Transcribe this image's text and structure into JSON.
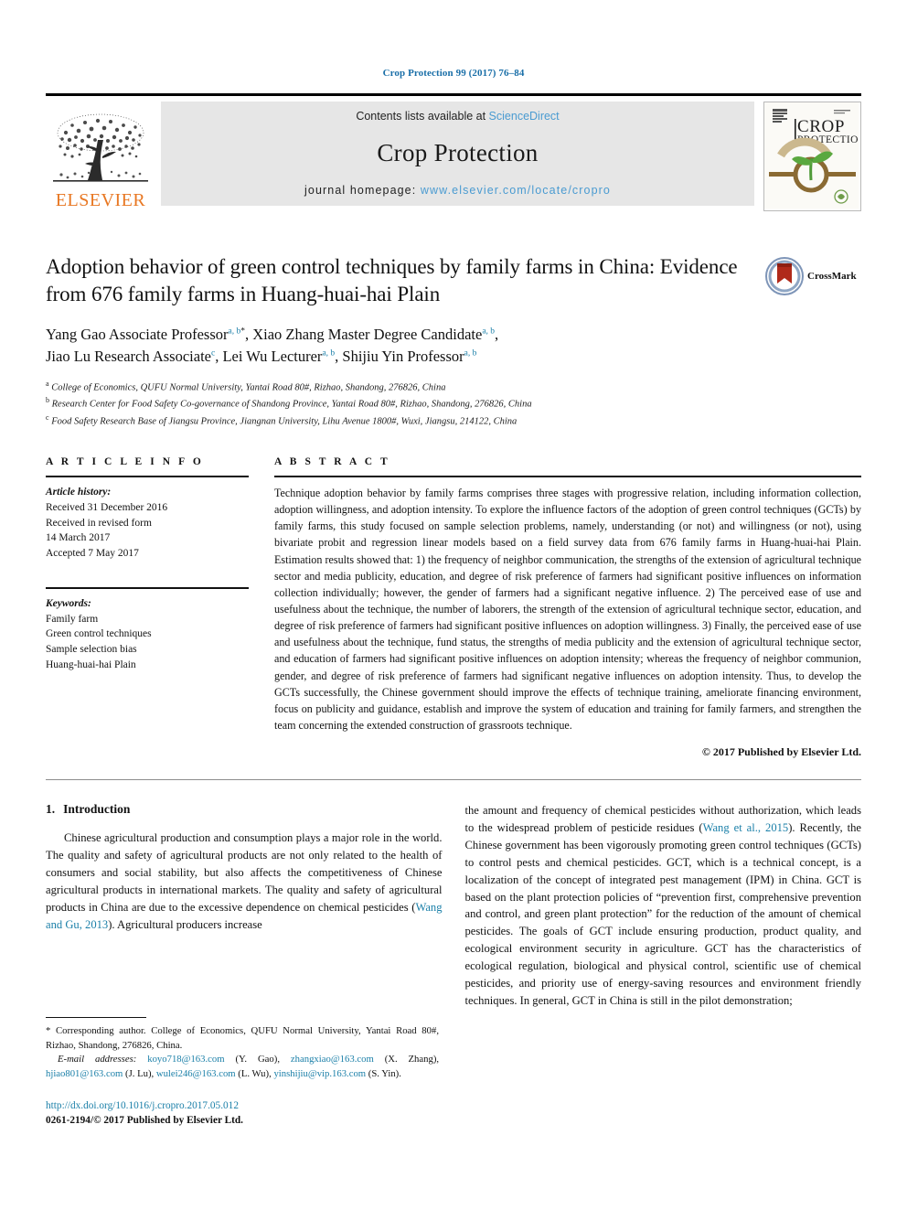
{
  "running_head": "Crop Protection 99 (2017) 76–84",
  "masthead": {
    "publisher_name": "ELSEVIER",
    "contents_prefix": "Contents lists available at ",
    "contents_link": "ScienceDirect",
    "journal_title": "Crop Protection",
    "homepage_prefix": "journal homepage: ",
    "homepage_url": "www.elsevier.com/locate/cropro",
    "cover_title_line1": "CROP",
    "cover_title_line2": "PROTECTION"
  },
  "article": {
    "title": "Adoption behavior of green control techniques by family farms in China: Evidence from 676 family farms in Huang-huai-hai Plain",
    "crossmark_label": "CrossMark",
    "authors_line1_a": "Yang Gao Associate Professor",
    "authors_line1_a_sup": "a, b",
    "authors_line1_a_star": "*",
    "authors_line1_b": ", Xiao Zhang Master Degree Candidate",
    "authors_line1_b_sup": "a, b",
    "authors_line1_b_tail": ",",
    "authors_line2_a": "Jiao Lu Research Associate",
    "authors_line2_a_sup": "c",
    "authors_line2_b": ", Lei Wu Lecturer",
    "authors_line2_b_sup": "a, b",
    "authors_line2_c": ", Shijiu Yin Professor",
    "authors_line2_c_sup": "a, b",
    "affiliations": [
      {
        "mark": "a",
        "text": "College of Economics, QUFU Normal University, Yantai Road 80#, Rizhao, Shandong, 276826, China"
      },
      {
        "mark": "b",
        "text": "Research Center for Food Safety Co-governance of Shandong Province, Yantai Road 80#, Rizhao, Shandong, 276826, China"
      },
      {
        "mark": "c",
        "text": "Food Safety Research Base of Jiangsu Province, Jiangnan University, Lihu Avenue 1800#, Wuxi, Jiangsu, 214122, China"
      }
    ]
  },
  "article_info": {
    "heading": "A R T I C L E   I N F O",
    "history_label": "Article history:",
    "history": [
      "Received 31 December 2016",
      "Received in revised form",
      "14 March 2017",
      "Accepted 7 May 2017"
    ],
    "keywords_label": "Keywords:",
    "keywords": [
      "Family farm",
      "Green control techniques",
      "Sample selection bias",
      "Huang-huai-hai Plain"
    ]
  },
  "abstract": {
    "heading": "A B S T R A C T",
    "text": "Technique adoption behavior by family farms comprises three stages with progressive relation, including information collection, adoption willingness, and adoption intensity. To explore the influence factors of the adoption of green control techniques (GCTs) by family farms, this study focused on sample selection problems, namely, understanding (or not) and willingness (or not), using bivariate probit and regression linear models based on a field survey data from 676 family farms in Huang-huai-hai Plain. Estimation results showed that: 1) the frequency of neighbor communication, the strengths of the extension of agricultural technique sector and media publicity, education, and degree of risk preference of farmers had significant positive influences on information collection individually; however, the gender of farmers had a significant negative influence. 2) The perceived ease of use and usefulness about the technique, the number of laborers, the strength of the extension of agricultural technique sector, education, and degree of risk preference of farmers had significant positive influences on adoption willingness. 3) Finally, the perceived ease of use and usefulness about the technique, fund status, the strengths of media publicity and the extension of agricultural technique sector, and education of farmers had significant positive influences on adoption intensity; whereas the frequency of neighbor communion, gender, and degree of risk preference of farmers had significant negative influences on adoption intensity. Thus, to develop the GCTs successfully, the Chinese government should improve the effects of technique training, ameliorate financing environment, focus on publicity and guidance, establish and improve the system of education and training for family farmers, and strengthen the team concerning the extended construction of grassroots technique.",
    "copyright": "© 2017 Published by Elsevier Ltd."
  },
  "introduction": {
    "number": "1.",
    "heading": "Introduction",
    "left_para_1": "Chinese agricultural production and consumption plays a major role in the world. The quality and safety of agricultural products are not only related to the health of consumers and social stability, but also affects the competitiveness of Chinese agricultural products in international markets. The quality and safety of agricultural products in China are due to the excessive dependence on chemical pesticides (",
    "left_ref_1": "Wang and Gu, 2013",
    "left_para_1_tail": "). Agricultural producers increase",
    "right_para_1_head": "the amount and frequency of chemical pesticides without authorization, which leads to the widespread problem of pesticide residues (",
    "right_ref_1": "Wang et al., 2015",
    "right_para_1_tail": "). Recently, the Chinese government has been vigorously promoting green control techniques (GCTs) to control pests and chemical pesticides. GCT, which is a technical concept, is a localization of the concept of integrated pest management (IPM) in China. GCT is based on the plant protection policies of “prevention first, comprehensive prevention and control, and green plant protection” for the reduction of the amount of chemical pesticides. The goals of GCT include ensuring production, product quality, and ecological environment security in agriculture. GCT has the characteristics of ecological regulation, biological and physical control, scientific use of chemical pesticides, and priority use of energy-saving resources and environment friendly techniques. In general, GCT in China is still in the pilot demonstration;"
  },
  "footnote": {
    "corresponding": "* Corresponding author. College of Economics, QUFU Normal University, Yantai Road 80#, Rizhao, Shandong, 276826, China.",
    "email_label": "E-mail addresses:",
    "emails": [
      {
        "addr": "koyo718@163.com",
        "who": "(Y. Gao),"
      },
      {
        "addr": "zhangxiao@163.com",
        "who": "(X. Zhang),"
      },
      {
        "addr": "hjiao801@163.com",
        "who": "(J. Lu),"
      },
      {
        "addr": "wulei246@163.com",
        "who": "(L. Wu),"
      },
      {
        "addr": "yinshijiu@vip.163.com",
        "who": "(S. Yin)."
      }
    ],
    "doi": "http://dx.doi.org/10.1016/j.cropro.2017.05.012",
    "issn_line": "0261-2194/© 2017 Published by Elsevier Ltd."
  },
  "colors": {
    "link": "#1a7fa8",
    "sciencedirect": "#4a9bd1",
    "elsevier_orange": "#E87722",
    "band_gray": "#e6e6e6"
  }
}
